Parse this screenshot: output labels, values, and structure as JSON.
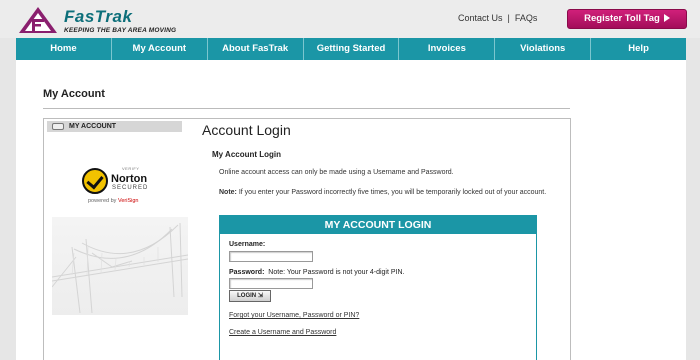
{
  "brand": {
    "name": "FasTrak",
    "tagline": "KEEPING THE BAY AREA MOVING",
    "name_color": "#0d6f7a",
    "accent_color": "#1b96a6",
    "cta_color": "#c2186f"
  },
  "header": {
    "contact_label": "Contact Us",
    "separator": "|",
    "faqs_label": "FAQs",
    "register_label": "Register Toll Tag"
  },
  "nav": {
    "items": [
      "Home",
      "My Account",
      "About FasTrak",
      "Getting Started",
      "Invoices",
      "Violations",
      "Help"
    ]
  },
  "page": {
    "title": "My Account"
  },
  "sidebar": {
    "tab_label": "MY ACCOUNT",
    "norton": {
      "verify": "VERIFY",
      "name": "Norton",
      "secured": "SECURED",
      "powered_by": "powered by",
      "powered_brand": "VeriSign"
    }
  },
  "main": {
    "heading": "Account Login",
    "subheading": "My Account Login",
    "description": "Online account access can only be made using a Username and Password.",
    "note_label": "Note:",
    "note_text": " If you enter your Password incorrectly five times, you will be temporarily locked out of your account."
  },
  "login_form": {
    "header": "MY ACCOUNT LOGIN",
    "username_label": "Username:",
    "username_value": "",
    "password_label": "Password:",
    "password_note": "Note: Your Password is not your 4-digit PIN.",
    "password_value": "",
    "login_button": "LOGIN",
    "forgot_link": "Forgot your Username, Password or PIN?",
    "create_link": "Create a Username and Password"
  }
}
